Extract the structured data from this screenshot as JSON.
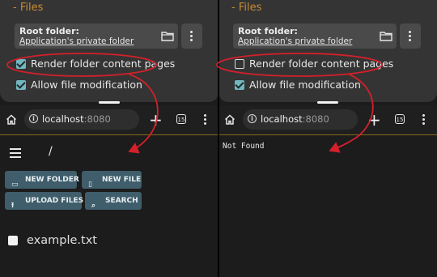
{
  "settings": {
    "section_title": "- Files",
    "root_folder_label": "Root folder:",
    "root_folder_value": "Application's private folder",
    "render_pages_label": "Render folder content pages",
    "allow_modification_label": "Allow file modification"
  },
  "panes": [
    {
      "render_pages_checked": true,
      "allow_modification_checked": true
    },
    {
      "render_pages_checked": false,
      "allow_modification_checked": true
    }
  ],
  "browser": {
    "host": "localhost",
    "port": ":8080",
    "tab_count": "15"
  },
  "file_browser": {
    "path": "/",
    "buttons": {
      "new_folder": "NEW FOLDER",
      "new_file": "NEW FILE",
      "upload_files": "UPLOAD FILES",
      "search": "SEARCH"
    },
    "files": [
      "example.txt"
    ]
  },
  "error_page": {
    "message": "Not Found"
  },
  "colors": {
    "accent": "#c98b33",
    "annotation": "#d4202a",
    "button_bg": "#3f5d6b",
    "checkbox_on": "#72b6c0"
  },
  "icons": [
    "folder-icon",
    "more-vert-icon",
    "home-icon",
    "info-icon",
    "plus-icon",
    "tabs-icon",
    "menu-icon",
    "hamburger-icon",
    "new-folder-icon",
    "new-file-icon",
    "upload-icon",
    "search-icon"
  ]
}
